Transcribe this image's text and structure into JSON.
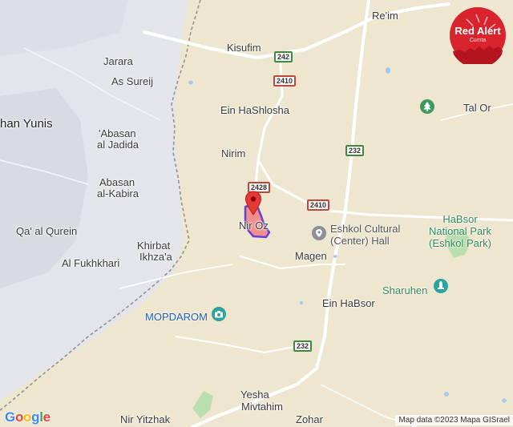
{
  "places": {
    "reim": "Re'im",
    "kisufim": "Kisufim",
    "jarara": "Jarara",
    "as_sureij": "As Sureij",
    "khan_yunis": "han Yunis",
    "ein_hashlosha": "Ein HaShlosha",
    "tal_or": "Tal Or",
    "abasan_jadida_1": "'Abasan",
    "abasan_jadida_2": "al Jadida",
    "nirim": "Nirim",
    "abasan_kabira_1": "Abasan",
    "abasan_kabira_2": "al-Kabira",
    "qa_al_qurein": "Qa' al Qurein",
    "nir_oz": "Nir Oz",
    "khirbat_1": "Khirbat",
    "khirbat_2": "Ikhza'a",
    "al_fukhkhari": "Al Fukhkhari",
    "magen": "Magen",
    "ein_habsor": "Ein HaBsor",
    "yesha": "Yesha",
    "mivtahim": "Mivtahim",
    "nir_yitzhak": "Nir Yitzhak",
    "zohar": "Zohar"
  },
  "pois": {
    "eshkol_hall_1": "Eshkol Cultural",
    "eshkol_hall_2": "(Center) Hall",
    "habsor_park_1": "HaBsor",
    "habsor_park_2": "National Park",
    "habsor_park_3": "(Eshkol Park)",
    "sharuhen": "Sharuhen",
    "mopdarom": "MOPDAROM"
  },
  "roads": {
    "r242": "242",
    "r2410a": "2410",
    "r232a": "232",
    "r2428": "2428",
    "r2410b": "2410",
    "r232b": "232"
  },
  "icons": {
    "alert_pin": "map-pin-icon",
    "hall": "landmark-icon",
    "park": "tree-icon",
    "sharuhen": "monument-icon",
    "mopdarom": "camera-icon"
  },
  "badge": {
    "title": "Red Alert",
    "subtitle": "Cumta"
  },
  "footer": {
    "google_logo": "Google",
    "attribution": "Map data ©2023 Mapa GISrael"
  },
  "colors": {
    "land": "#efe6d0",
    "urban": "#e2e4e8",
    "alert_fill": "#f08080",
    "alert_outline": "#6a3fd6",
    "pin": "#e53935",
    "badge": "#d9232d",
    "road": "#ffffff",
    "border_line": "#8e8e8e",
    "poi_blue": "#1e5fae",
    "poi_green": "#2e8b57"
  }
}
